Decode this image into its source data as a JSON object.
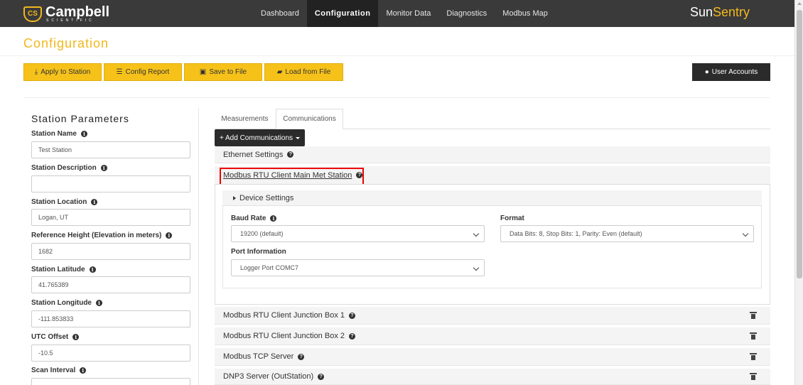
{
  "brand": {
    "badge": "CS",
    "name": "Campbell",
    "sub": "SCIENTIFIC",
    "product_part1": "Sun",
    "product_part2": "Sentry"
  },
  "nav": {
    "items": [
      {
        "label": "Dashboard"
      },
      {
        "label": "Configuration"
      },
      {
        "label": "Monitor Data"
      },
      {
        "label": "Diagnostics"
      },
      {
        "label": "Modbus Map"
      }
    ]
  },
  "page": {
    "title": "Configuration"
  },
  "toolbar": {
    "apply": "Apply to Station",
    "report": "Config Report",
    "save": "Save to File",
    "load": "Load from File",
    "users": "User Accounts"
  },
  "station": {
    "title": "Station Parameters",
    "fields": [
      {
        "label": "Station Name",
        "value": "Test Station"
      },
      {
        "label": "Station Description",
        "value": ""
      },
      {
        "label": "Station Location",
        "value": "Logan, UT"
      },
      {
        "label": "Reference Height (Elevation in meters)",
        "value": "1682"
      },
      {
        "label": "Station Latitude",
        "value": "41.765389"
      },
      {
        "label": "Station Longitude",
        "value": "-111.853833"
      },
      {
        "label": "UTC Offset",
        "value": "-10.5"
      },
      {
        "label": "Scan Interval",
        "value": ""
      }
    ]
  },
  "tabs": [
    {
      "label": "Measurements"
    },
    {
      "label": "Communications"
    }
  ],
  "add_button": "+ Add Communications",
  "comms": {
    "ethernet": "Ethernet Settings",
    "active": "Modbus RTU Client Main Met Station",
    "device_settings": "Device Settings",
    "baud_label": "Baud Rate",
    "baud_value": "19200 (default)",
    "format_label": "Format",
    "format_value": "Data Bits: 8, Stop Bits: 1, Parity: Even (default)",
    "port_label": "Port Information",
    "port_value": "Logger Port COMC7",
    "others": [
      "Modbus RTU Client Junction Box 1",
      "Modbus RTU Client Junction Box 2",
      "Modbus TCP Server",
      "DNP3 Server (OutStation)"
    ]
  },
  "colors": {
    "accent": "#f6c21a",
    "title": "#f1b81c",
    "nav_bg": "#3a3a3a",
    "highlight": "#ee0000"
  }
}
